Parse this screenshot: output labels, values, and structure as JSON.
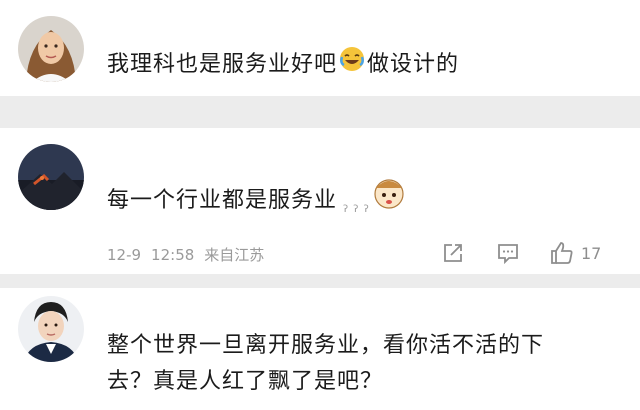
{
  "comments": [
    {
      "text_before_emoji": "我理科也是服务业好吧",
      "emoji": "crying-laughing-emoji",
      "text_after_emoji": "做设计的"
    },
    {
      "text": "每一个行业都是服务业",
      "sticker": "cartoon-sticker",
      "date": "12-9",
      "time": "12:58",
      "location": "来自江苏",
      "actions": {
        "share_icon": "share-icon",
        "comment_icon": "comment-icon",
        "like_icon": "thumbs-up-icon",
        "like_count": "17"
      }
    },
    {
      "line1": "整个世界一旦离开服务业，看你活不活的下",
      "line2": "去？真是人红了飘了是吧？"
    }
  ]
}
